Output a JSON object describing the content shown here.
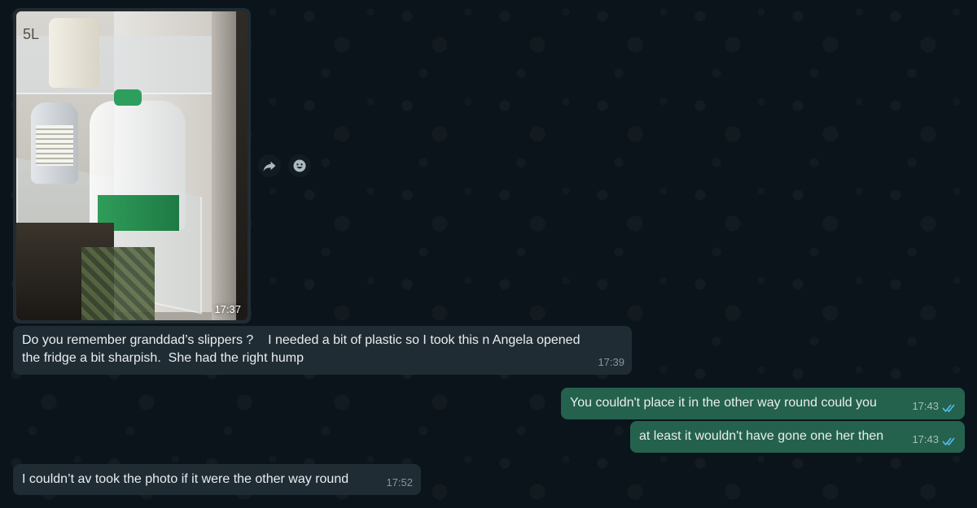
{
  "chat": {
    "image_message": {
      "photo_text": "5L",
      "time": "17:37"
    },
    "actions": {
      "forward_label": "Forward",
      "react_label": "React"
    },
    "messages": [
      {
        "direction": "in",
        "line1": "Do you remember granddad’s slippers ?    I needed a bit of plastic so I took this n Angela opened",
        "line2": "the fridge a bit sharpish.  She had the right hump",
        "time": "17:39"
      },
      {
        "direction": "out",
        "text": "You couldn't place it in the other way round could you",
        "time": "17:43",
        "status": "read"
      },
      {
        "direction": "out",
        "text": "at least it wouldn't have gone one her then",
        "time": "17:43",
        "status": "read"
      },
      {
        "direction": "in",
        "text": "I couldn’t av took the photo if it were the other way round",
        "time": "17:52"
      }
    ]
  },
  "colors": {
    "background": "#0b141a",
    "incoming_bubble": "#202c33",
    "outgoing_bubble": "#24624d",
    "read_ticks": "#53bdeb"
  },
  "icons": {
    "forward": "forward-arrow-icon",
    "react": "smiley-icon",
    "read": "double-check-icon"
  }
}
